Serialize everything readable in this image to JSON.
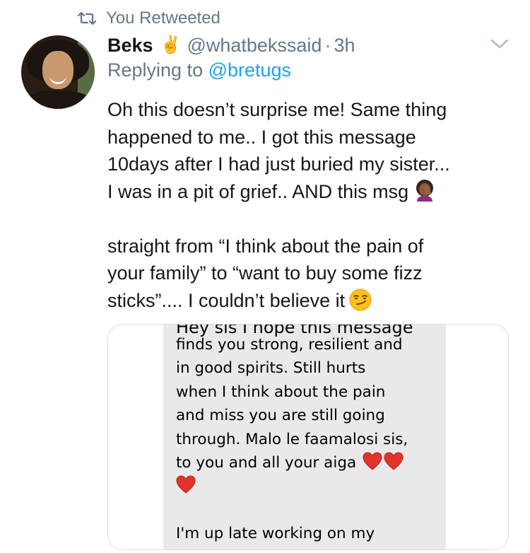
{
  "retweet": {
    "icon": "retweet-icon",
    "label": "You Retweeted"
  },
  "author": {
    "avatar": "avatar",
    "name": "Beks",
    "name_emoji": "✌",
    "handle": "@whatbekssaid",
    "separator": "·",
    "time": "3h"
  },
  "reply": {
    "prefix": "Replying to ",
    "mention": "@bretugs"
  },
  "tweet": {
    "line1": "Oh this doesn’t surprise me! Same thing",
    "line2": "happened to me.. I got this message",
    "line3": "10days after I had just buried my sister...",
    "line4": "I was in a pit of grief.. AND this msg",
    "line5": "straight from “I think about the pain of",
    "line6": "your family” to “want to buy some fizz",
    "line7": "sticks”.... I couldn’t believe it",
    "emoji_facepalm": "facepalm-emoji",
    "emoji_smirk": "smirk-emoji"
  },
  "media": {
    "cut_line": "Hey sis I hope this message",
    "lines": [
      "finds you strong, resilient and",
      "in good spirits.  Still hurts",
      "when I think about the pain",
      "and miss you are still going",
      "through.  Malo le faamalosi sis,",
      "to you and all your aiga",
      "",
      "",
      "I'm up late working on my"
    ],
    "heart_icon": "red-heart-emoji"
  },
  "colors": {
    "text": "#14171a",
    "secondary": "#657786",
    "link": "#1da1f2",
    "card_border": "#d7dde2",
    "message_background": "#e9e9eb",
    "heart": "#e0342a"
  }
}
